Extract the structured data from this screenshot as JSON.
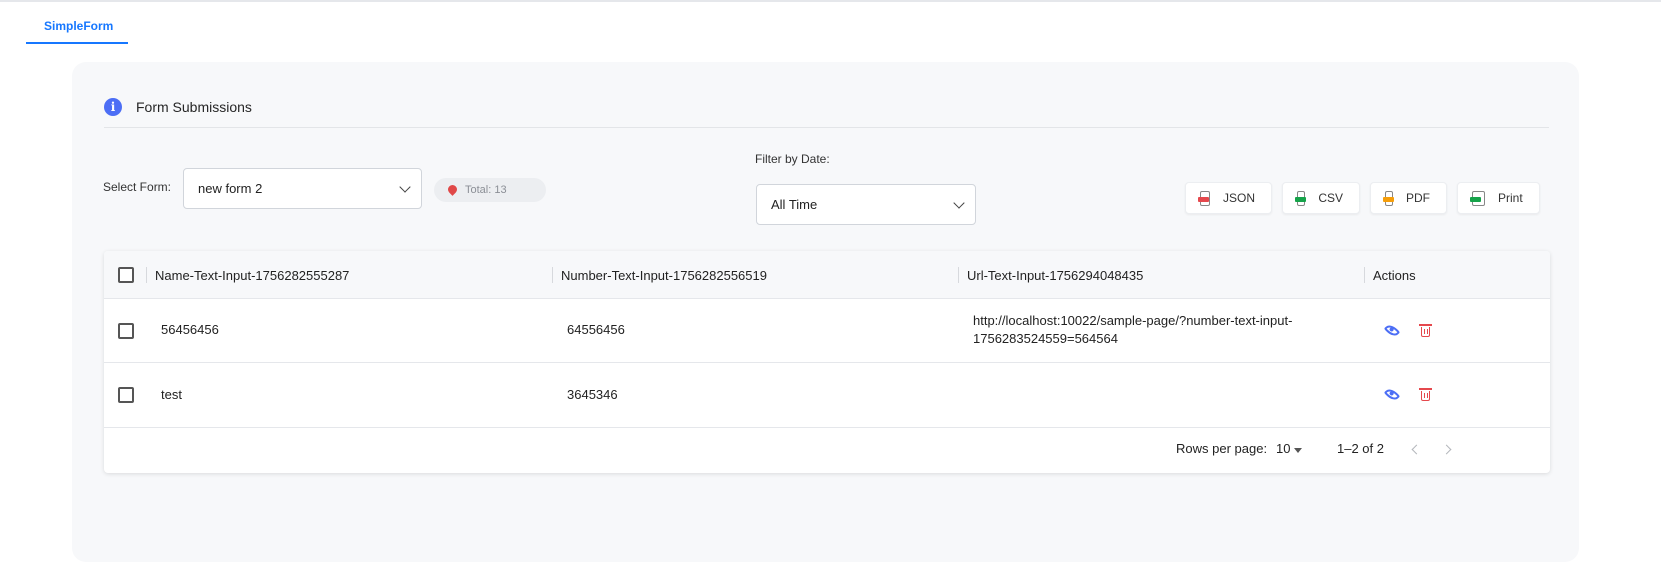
{
  "app": {
    "tab_label": "SimpleForm"
  },
  "card": {
    "title": "Form Submissions",
    "info_icon": "i"
  },
  "filters": {
    "select_form_label": "Select Form:",
    "selected_form": "new form 2",
    "total_label": "Total: 13",
    "date_label": "Filter by Date:",
    "selected_date": "All Time"
  },
  "exports": [
    {
      "label": "JSON",
      "icon": "json-file-icon",
      "color": "#e5484d"
    },
    {
      "label": "CSV",
      "icon": "csv-file-icon",
      "color": "#16a34a"
    },
    {
      "label": "PDF",
      "icon": "pdf-file-icon",
      "color": "#f59e0b"
    },
    {
      "label": "Print",
      "icon": "print-file-icon",
      "color": "#16a34a"
    }
  ],
  "table": {
    "columns": [
      "Name-Text-Input-1756282555287",
      "Number-Text-Input-1756282556519",
      "Url-Text-Input-1756294048435",
      "Actions"
    ],
    "rows": [
      {
        "name": "56456456",
        "number": "64556456",
        "url_line1": "http://localhost:10022/sample-page/?number-text-input-",
        "url_line2": "1756283524559=564564"
      },
      {
        "name": "test",
        "number": "3645346",
        "url_line1": "",
        "url_line2": ""
      }
    ]
  },
  "pagination": {
    "rows_per_page_label": "Rows per page:",
    "rows_per_page": "10",
    "range": "1–2 of 2"
  },
  "colors": {
    "accent": "#1677ff",
    "info": "#4c6ef5",
    "danger": "#e5484d"
  }
}
